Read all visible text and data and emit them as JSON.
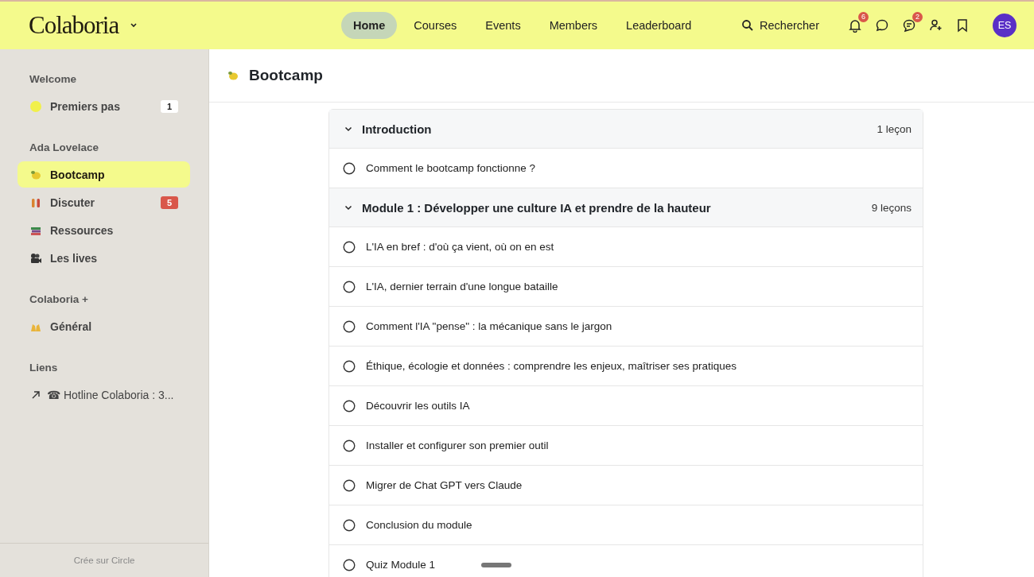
{
  "header": {
    "logo": "Colaboria",
    "nav": [
      {
        "label": "Home",
        "selected": true
      },
      {
        "label": "Courses",
        "selected": false
      },
      {
        "label": "Events",
        "selected": false
      },
      {
        "label": "Members",
        "selected": false
      },
      {
        "label": "Leaderboard",
        "selected": false
      }
    ],
    "search": {
      "label": "Rechercher"
    },
    "notifications_count": "6",
    "chat_count": "2",
    "avatar": "ES"
  },
  "sidebar": {
    "groups": [
      {
        "title": "Welcome",
        "items": [
          {
            "label": "Premiers pas",
            "selected": false,
            "badge": {
              "text": "1",
              "kind": "plain"
            }
          }
        ]
      },
      {
        "title": "Ada Lovelace",
        "items": [
          {
            "label": "Bootcamp",
            "selected": true
          },
          {
            "label": "Discuter",
            "selected": false,
            "badge": {
              "text": "5",
              "kind": "alert"
            }
          },
          {
            "label": "Ressources",
            "selected": false
          },
          {
            "label": "Les lives",
            "selected": false
          }
        ]
      },
      {
        "title": "Colaboria +",
        "items": [
          {
            "label": "Général",
            "selected": false
          }
        ]
      },
      {
        "title": "Liens",
        "items": [
          {
            "label": "☎ Hotline Colaboria : 3...",
            "selected": false,
            "kind": "link"
          }
        ]
      }
    ],
    "footer": "Crée sur Circle"
  },
  "page": {
    "title": "Bootcamp",
    "sections": [
      {
        "title": "Introduction",
        "count": "1 leçon",
        "expanded": true,
        "lessons": [
          {
            "title": "Comment le bootcamp fonctionne ?",
            "done": false
          }
        ]
      },
      {
        "title": "Module 1 : Développer une culture IA et prendre de la hauteur",
        "count": "9 leçons",
        "expanded": true,
        "lessons": [
          {
            "title": "L'IA en bref : d'où ça vient, où on en est",
            "done": false
          },
          {
            "title": "L'IA, dernier terrain d'une longue bataille",
            "done": false
          },
          {
            "title": "Comment l'IA \"pense\" : la mécanique sans le jargon",
            "done": false
          },
          {
            "title": "Éthique, écologie et données : comprendre les enjeux, maîtriser ses pratiques",
            "done": false
          },
          {
            "title": "Découvrir les outils IA",
            "done": false
          },
          {
            "title": "Installer et configurer son premier outil",
            "done": false
          },
          {
            "title": "Migrer de Chat GPT vers Claude",
            "done": false
          },
          {
            "title": "Conclusion du module",
            "done": false
          },
          {
            "title": "Quiz Module 1",
            "done": false
          }
        ]
      }
    ]
  }
}
